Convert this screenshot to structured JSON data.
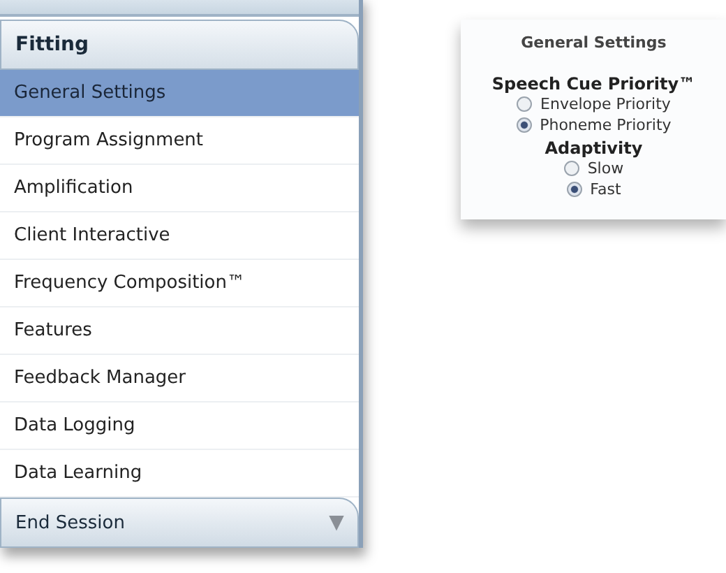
{
  "sidebar": {
    "section": "Fitting",
    "items": [
      {
        "label": "General Settings",
        "selected": true
      },
      {
        "label": "Program Assignment",
        "selected": false
      },
      {
        "label": "Amplification",
        "selected": false
      },
      {
        "label": "Client Interactive",
        "selected": false
      },
      {
        "label": "Frequency Composition™",
        "selected": false
      },
      {
        "label": "Features",
        "selected": false
      },
      {
        "label": "Feedback Manager",
        "selected": false
      },
      {
        "label": "Data Logging",
        "selected": false
      },
      {
        "label": "Data Learning",
        "selected": false
      }
    ],
    "footer": {
      "label": "End Session",
      "icon": "▼"
    }
  },
  "panel": {
    "title": "General Settings",
    "groups": [
      {
        "title": "Speech Cue Priority™",
        "options": [
          {
            "label": "Envelope Priority",
            "selected": false
          },
          {
            "label": "Phoneme Priority",
            "selected": true
          }
        ]
      },
      {
        "title": "Adaptivity",
        "options": [
          {
            "label": "Slow",
            "selected": false
          },
          {
            "label": "Fast",
            "selected": true
          }
        ]
      }
    ]
  }
}
